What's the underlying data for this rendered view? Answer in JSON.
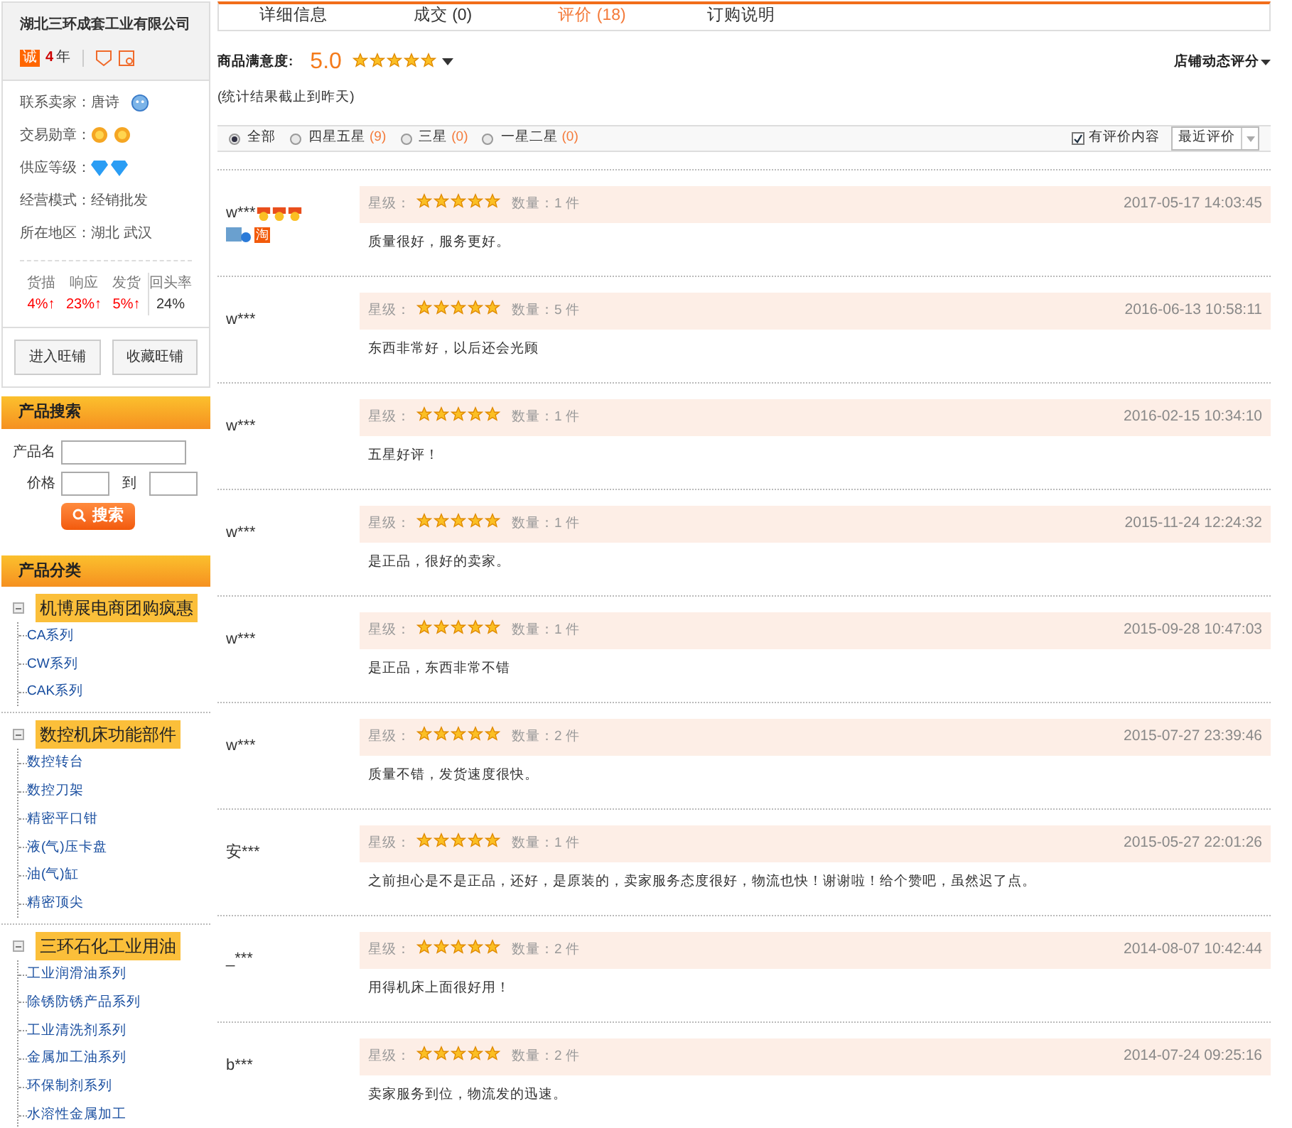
{
  "shop": {
    "name": "湖北三环成套工业有限公司",
    "badge": "诚",
    "years": "4",
    "years_unit": "年",
    "info": [
      {
        "kind": "contact",
        "label": "联系卖家：",
        "value": "唐诗"
      },
      {
        "kind": "medals",
        "label": "交易勋章：",
        "icons": [
          {
            "kind": "medal"
          },
          {
            "kind": "medal"
          }
        ]
      },
      {
        "kind": "diamonds",
        "label": "供应等级：",
        "icons": [
          {
            "kind": "diamond"
          },
          {
            "kind": "diamond"
          }
        ]
      },
      {
        "kind": "text",
        "label": "经营模式：",
        "value": "经销批发"
      },
      {
        "kind": "text",
        "label": "所在地区：",
        "value": "湖北 武汉"
      }
    ],
    "stats": [
      {
        "label": "货描",
        "value": "4%↑",
        "kind": "up"
      },
      {
        "label": "响应",
        "value": "23%↑",
        "kind": "up"
      },
      {
        "label": "发货",
        "value": "5%↑",
        "kind": "up"
      },
      {
        "label": "回头率",
        "value": "24%",
        "kind": "plain"
      }
    ],
    "buttons": [
      "进入旺铺",
      "收藏旺铺"
    ]
  },
  "search": {
    "title": "产品搜索",
    "name_label": "产品名",
    "price_label": "价格",
    "to_label": "到",
    "button": "搜索"
  },
  "categories": {
    "title": "产品分类",
    "groups": [
      {
        "name": "机博展电商团购疯惠",
        "expanded": true,
        "children": [
          "CA系列",
          "CW系列",
          "CAK系列"
        ]
      },
      {
        "name": "数控机床功能部件",
        "expanded": true,
        "children": [
          "数控转台",
          "数控刀架",
          "精密平口钳",
          "液(气)压卡盘",
          "油(气)缸",
          "精密顶尖"
        ]
      },
      {
        "name": "三环石化工业用油",
        "expanded": true,
        "children": [
          "工业润滑油系列",
          "除锈防锈产品系列",
          "工业清洗剂系列",
          "金属加工油系列",
          "环保制剂系列",
          "水溶性金属加工"
        ]
      }
    ]
  },
  "tabs": [
    {
      "label": "详细信息",
      "selected": false
    },
    {
      "label": "成交 (0)",
      "selected": false
    },
    {
      "label": "评价 (18)",
      "selected": true
    },
    {
      "label": "订购说明",
      "selected": false
    }
  ],
  "satisfaction": {
    "label": "商品满意度:",
    "score": "5.0",
    "stars": 5,
    "note": "(统计结果截止到昨天)",
    "shop_rating": "店铺动态评分"
  },
  "filters": [
    {
      "label": "全部",
      "selected": true
    },
    {
      "label": "四星五星",
      "count": "(9)",
      "selected": false
    },
    {
      "label": "三星",
      "count": "(0)",
      "selected": false
    },
    {
      "label": "一星二星",
      "count": "(0)",
      "selected": false
    }
  ],
  "has_content": {
    "label": "有评价内容",
    "checked": true
  },
  "sort": {
    "value": "最近评价"
  },
  "reviews": [
    {
      "user": "w***",
      "medals": [
        {
          "kind": "crown"
        },
        {
          "kind": "crown"
        },
        {
          "kind": "crown"
        }
      ],
      "badge": "淘",
      "grade_label": "星级：",
      "stars": 5,
      "qty": "数量：1 件",
      "time": "2017-05-17 14:03:45",
      "text": "质量很好，服务更好。"
    },
    {
      "user": "w***",
      "grade_label": "星级：",
      "stars": 5,
      "qty": "数量：5 件",
      "time": "2016-06-13 10:58:11",
      "text": "东西非常好，以后还会光顾"
    },
    {
      "user": "w***",
      "grade_label": "星级：",
      "stars": 5,
      "qty": "数量：1 件",
      "time": "2016-02-15 10:34:10",
      "text": "五星好评！"
    },
    {
      "user": "w***",
      "grade_label": "星级：",
      "stars": 5,
      "qty": "数量：1 件",
      "time": "2015-11-24 12:24:32",
      "text": "是正品，很好的卖家。"
    },
    {
      "user": "w***",
      "grade_label": "星级：",
      "stars": 5,
      "qty": "数量：1 件",
      "time": "2015-09-28 10:47:03",
      "text": "是正品，东西非常不错"
    },
    {
      "user": "w***",
      "grade_label": "星级：",
      "stars": 5,
      "qty": "数量：2 件",
      "time": "2015-07-27 23:39:46",
      "text": "质量不错，发货速度很快。"
    },
    {
      "user": "安***",
      "grade_label": "星级：",
      "stars": 5,
      "qty": "数量：1 件",
      "time": "2015-05-27 22:01:26",
      "text": "之前担心是不是正品，还好，是原装的，卖家服务态度很好，物流也快！谢谢啦！给个赞吧，虽然迟了点。"
    },
    {
      "user": "_***",
      "grade_label": "星级：",
      "stars": 5,
      "qty": "数量：2 件",
      "time": "2014-08-07 10:42:44",
      "text": "用得机床上面很好用！"
    },
    {
      "user": "b***",
      "grade_label": "星级：",
      "stars": 5,
      "qty": "数量：2 件",
      "time": "2014-07-24 09:25:16",
      "text": "卖家服务到位，物流发的迅速。"
    }
  ]
}
